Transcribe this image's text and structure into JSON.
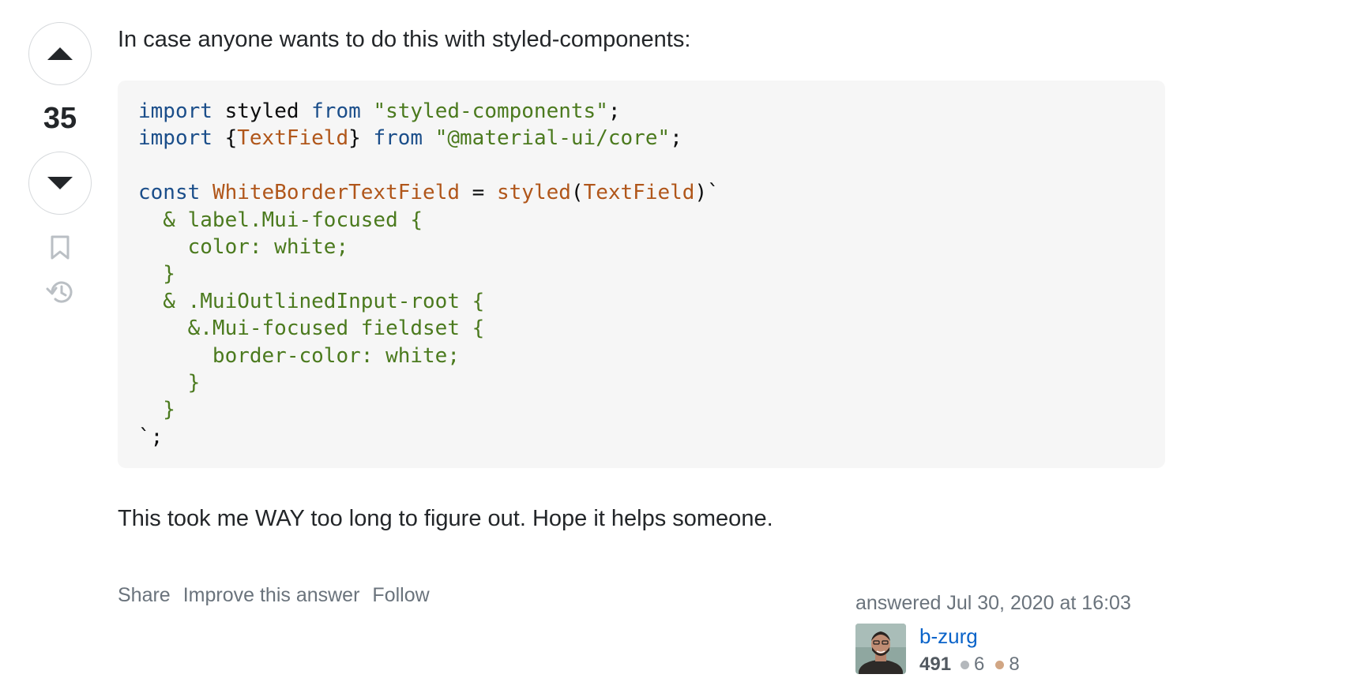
{
  "vote": {
    "count": "35"
  },
  "post": {
    "intro": "In case anyone wants to do this with styled-components:",
    "code_lines": [
      [
        {
          "t": "kw",
          "v": "import"
        },
        {
          "t": "txt",
          "v": " styled "
        },
        {
          "t": "kw",
          "v": "from"
        },
        {
          "t": "txt",
          "v": " "
        },
        {
          "t": "str",
          "v": "\"styled-components\""
        },
        {
          "t": "txt",
          "v": ";"
        }
      ],
      [
        {
          "t": "kw",
          "v": "import"
        },
        {
          "t": "txt",
          "v": " {"
        },
        {
          "t": "fn",
          "v": "TextField"
        },
        {
          "t": "txt",
          "v": "} "
        },
        {
          "t": "kw",
          "v": "from"
        },
        {
          "t": "txt",
          "v": " "
        },
        {
          "t": "str",
          "v": "\"@material-ui/core\""
        },
        {
          "t": "txt",
          "v": ";"
        }
      ],
      [],
      [
        {
          "t": "kw",
          "v": "const"
        },
        {
          "t": "txt",
          "v": " "
        },
        {
          "t": "fn",
          "v": "WhiteBorderTextField"
        },
        {
          "t": "txt",
          "v": " = "
        },
        {
          "t": "fn",
          "v": "styled"
        },
        {
          "t": "txt",
          "v": "("
        },
        {
          "t": "fn",
          "v": "TextField"
        },
        {
          "t": "txt",
          "v": ")`"
        }
      ],
      [
        {
          "t": "str",
          "v": "  & label.Mui-focused {"
        }
      ],
      [
        {
          "t": "str",
          "v": "    color: white;"
        }
      ],
      [
        {
          "t": "str",
          "v": "  }"
        }
      ],
      [
        {
          "t": "str",
          "v": "  & .MuiOutlinedInput-root {"
        }
      ],
      [
        {
          "t": "str",
          "v": "    &.Mui-focused fieldset {"
        }
      ],
      [
        {
          "t": "str",
          "v": "      border-color: white;"
        }
      ],
      [
        {
          "t": "str",
          "v": "    }"
        }
      ],
      [
        {
          "t": "str",
          "v": "  }"
        }
      ],
      [
        {
          "t": "txt",
          "v": "`;"
        }
      ]
    ],
    "outro": "This took me WAY too long to figure out. Hope it helps someone."
  },
  "menu": {
    "share": "Share",
    "improve": "Improve this answer",
    "follow": "Follow"
  },
  "user": {
    "action_time": "answered Jul 30, 2020 at 16:03",
    "name": "b-zurg",
    "reputation": "491",
    "silver_badges": "6",
    "bronze_badges": "8"
  },
  "colors": {
    "silver": "#b4b8bc",
    "bronze": "#d1a684",
    "link": "#0a63c9",
    "keyword": "#1b4e8a",
    "string": "#4b7a1e",
    "identifier": "#b0561a"
  },
  "icons": {
    "upvote": "upvote-arrow-icon",
    "downvote": "downvote-arrow-icon",
    "bookmark": "bookmark-icon",
    "history": "history-icon"
  }
}
